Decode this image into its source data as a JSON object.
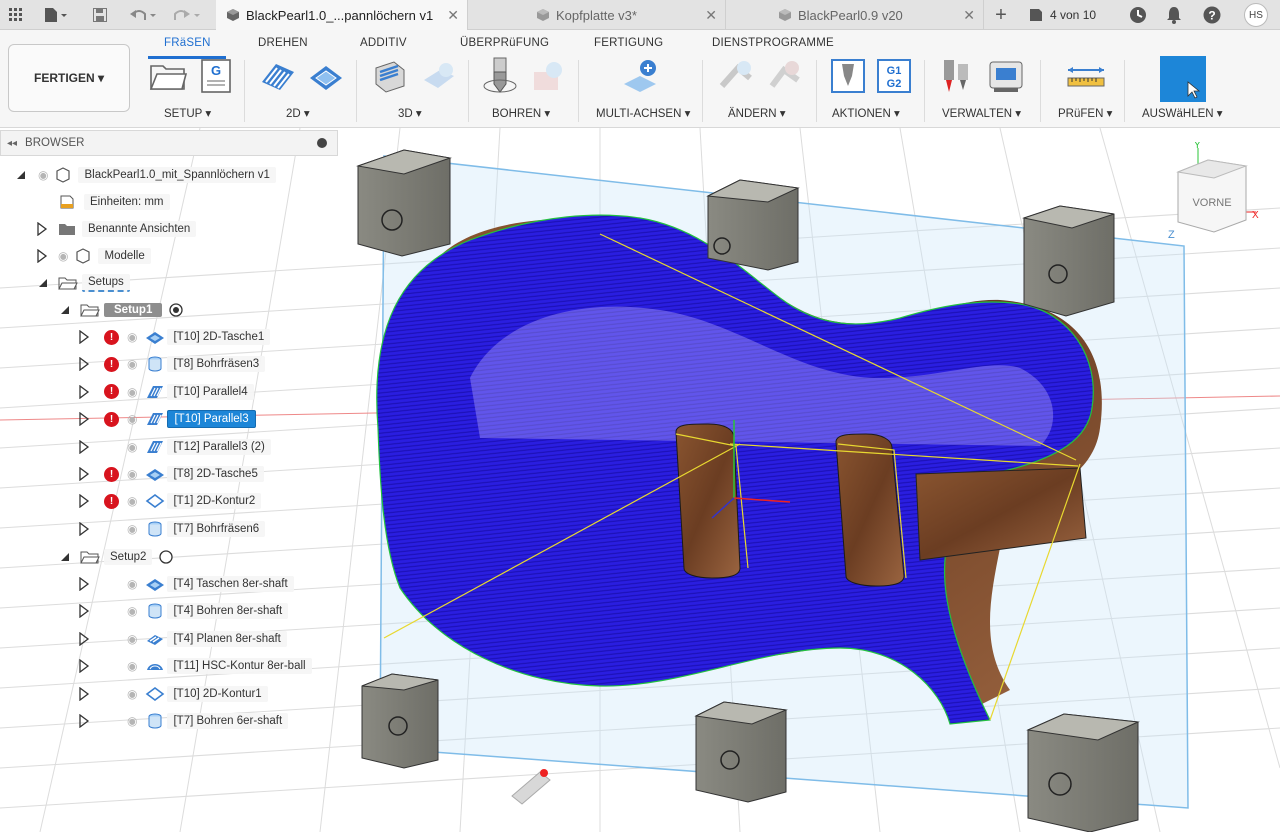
{
  "titlebar": {
    "tabs": [
      {
        "label": "BlackPearl1.0_...pannlöchern v1",
        "active": true
      },
      {
        "label": "Kopfplatte v3*",
        "active": false
      },
      {
        "label": "BlackPearl0.9 v20",
        "active": false
      }
    ],
    "counter": "4 von 10",
    "avatar": "HS"
  },
  "ribbon": {
    "workspace": "FERTIGEN ▾",
    "tabs": [
      "FRäSEN",
      "DREHEN",
      "ADDITIV",
      "ÜBERPRüFUNG",
      "FERTIGUNG",
      "DIENSTPROGRAMME"
    ],
    "groups": [
      "SETUP ▾",
      "2D ▾",
      "3D ▾",
      "BOHREN ▾",
      "MULTI-ACHSEN ▾",
      "ÄNDERN ▾",
      "AKTIONEN ▾",
      "VERWALTEN ▾",
      "PRüFEN ▾",
      "AUSWäHLEN ▾"
    ],
    "g1g2": "G1\nG2"
  },
  "browser": {
    "title": "BROWSER",
    "root": "BlackPearl1.0_mit_Spannlöchern v1",
    "units": "Einheiten: mm",
    "named_views": "Benannte Ansichten",
    "models": "Modelle",
    "setups": "Setups",
    "setup1": {
      "label": "Setup1",
      "ops": [
        {
          "label": "[T10] 2D-Tasche1",
          "error": true,
          "icon": "pocket-2d-icon"
        },
        {
          "label": "[T8] Bohrfräsen3",
          "error": true,
          "icon": "bore-icon"
        },
        {
          "label": "[T10] Parallel4",
          "error": true,
          "icon": "parallel-icon"
        },
        {
          "label": "[T10] Parallel3",
          "error": true,
          "icon": "parallel-icon",
          "selected": true
        },
        {
          "label": "[T12] Parallel3 (2)",
          "error": false,
          "icon": "parallel-icon"
        },
        {
          "label": "[T8] 2D-Tasche5",
          "error": true,
          "icon": "pocket-2d-icon"
        },
        {
          "label": "[T1] 2D-Kontur2",
          "error": true,
          "icon": "contour-2d-icon"
        },
        {
          "label": "[T7] Bohrfräsen6",
          "error": false,
          "icon": "bore-icon"
        }
      ]
    },
    "setup2": {
      "label": "Setup2",
      "ops": [
        {
          "label": "[T4] Taschen 8er-shaft",
          "icon": "pocket-2d-icon"
        },
        {
          "label": "[T4] Bohren 8er-shaft",
          "icon": "bore-icon"
        },
        {
          "label": "[T4] Planen 8er-shaft",
          "icon": "face-icon"
        },
        {
          "label": "[T11] HSC-Kontur 8er-ball",
          "icon": "contour-3d-icon"
        },
        {
          "label": "[T10] 2D-Kontur1",
          "icon": "contour-2d-icon"
        },
        {
          "label": "[T7] Bohren 6er-shaft",
          "icon": "bore-icon"
        }
      ]
    }
  },
  "viewcube": {
    "face": "VORNE",
    "x_axis": "X",
    "y_axis": "Y",
    "z_axis": "Z"
  },
  "colors": {
    "accent": "#1f6fd0",
    "toolpath": "#2b1fd8",
    "wood": "#7a4a2a",
    "error": "#d8141e",
    "selection": "#1d86d8"
  }
}
